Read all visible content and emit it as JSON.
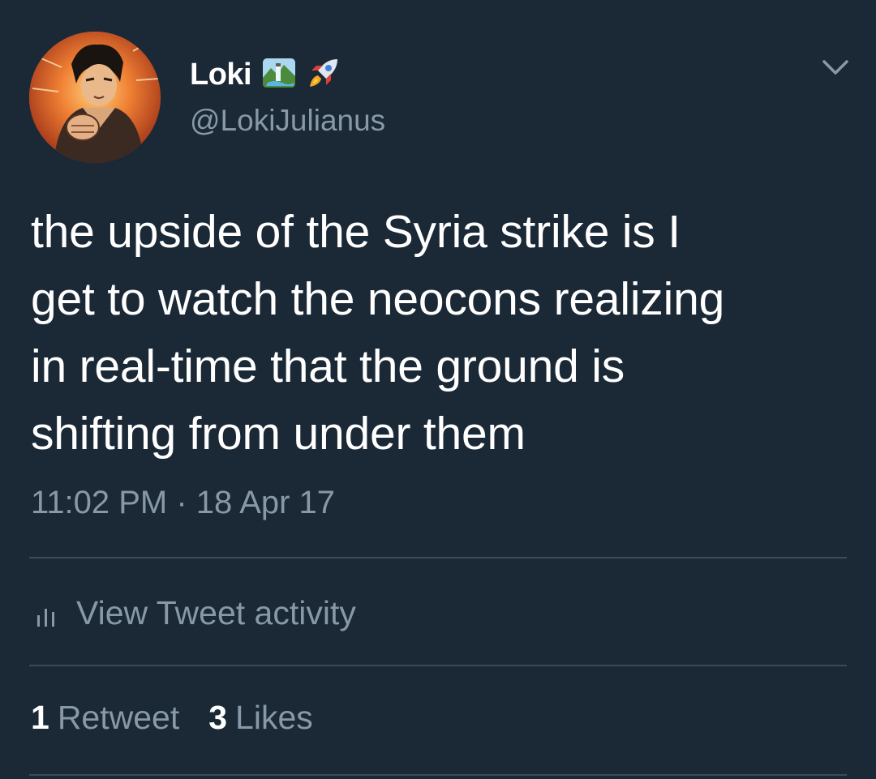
{
  "user": {
    "display_name": "Loki",
    "handle": "@LokiJulianus",
    "name_emojis": [
      "waterfall-landscape-emoji",
      "rocket-emoji"
    ]
  },
  "tweet": {
    "lines": [
      "the upside of the Syria strike is I",
      "get to watch the neocons realizing",
      "in real-time that the ground is",
      "shifting from under them"
    ],
    "timestamp": "11:02 PM · 18 Apr 17"
  },
  "activity": {
    "label": "View Tweet activity",
    "icon": "bar-chart-icon"
  },
  "stats": {
    "retweets_count": "1",
    "retweets_label": "Retweet",
    "likes_count": "3",
    "likes_label": "Likes"
  },
  "menu": {
    "icon": "chevron-down-icon"
  },
  "colors": {
    "background": "#1b2836",
    "primary_text": "#ffffff",
    "secondary_text": "#8899a6",
    "divider": "#3b4b5b"
  }
}
